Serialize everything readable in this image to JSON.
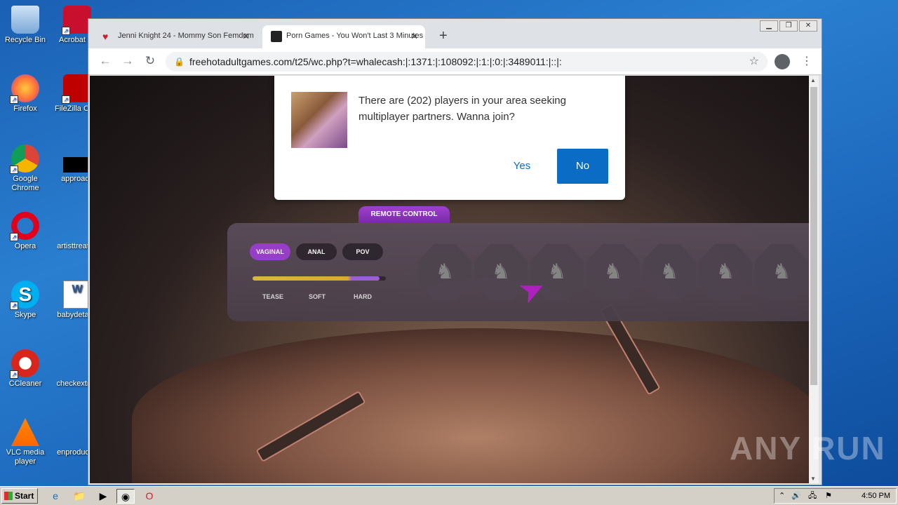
{
  "desktop": {
    "icons": [
      {
        "label": "Recycle Bin"
      },
      {
        "label": "Acrobat Reader"
      },
      {
        "label": "Firefox"
      },
      {
        "label": "FileZilla Client"
      },
      {
        "label": "Google Chrome"
      },
      {
        "label": "approach"
      },
      {
        "label": "Opera"
      },
      {
        "label": "artisttreat"
      },
      {
        "label": "Skype"
      },
      {
        "label": "babydeta"
      },
      {
        "label": "CCleaner"
      },
      {
        "label": "checkextr"
      },
      {
        "label": "VLC media player"
      },
      {
        "label": "enproduc"
      }
    ]
  },
  "browser": {
    "tabs": [
      {
        "title": "Jenni Knight 24 - Mommy Son Femdom",
        "close": "✕"
      },
      {
        "title": "Porn Games - You Won't Last 3 Minutes",
        "close": "✕"
      }
    ],
    "new_tab": "+",
    "url": "freehotadultgames.com/t25/wc.php?t=whalecash:|:1371:|:108092:|:1:|:0:|:3489011:|::|:"
  },
  "page": {
    "remote_control_label": "REMOTE CONTROL",
    "modes": [
      "VAGINAL",
      "ANAL",
      "POV"
    ],
    "intensity_labels": [
      "TEASE",
      "SOFT",
      "HARD"
    ],
    "intensity_level": 0.95
  },
  "modal": {
    "message": "There are (202) players in your area seeking multiplayer partners. Wanna join?",
    "yes_label": "Yes",
    "no_label": "No"
  },
  "watermark": "ANY RUN",
  "taskbar": {
    "start_label": "Start",
    "clock": "4:50 PM"
  }
}
